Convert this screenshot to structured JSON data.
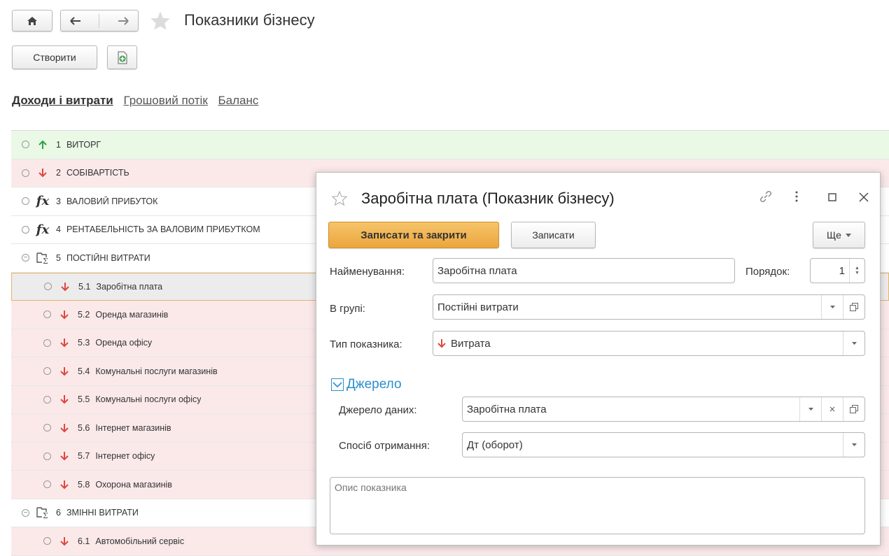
{
  "header": {
    "title": "Показники бізнесу",
    "create_label": "Створити"
  },
  "tabs": [
    {
      "label": "Доходи і витрати",
      "active": true
    },
    {
      "label": "Грошовий потік",
      "active": false
    },
    {
      "label": "Баланс",
      "active": false
    }
  ],
  "list": {
    "rows": [
      {
        "num": "1",
        "name": "ВИТОРГ",
        "icon": "arrow-up-icon",
        "level": 0
      },
      {
        "num": "2",
        "name": "СОБІВАРТІСТЬ",
        "icon": "arrow-down-icon",
        "level": 0
      },
      {
        "num": "3",
        "name": "ВАЛОВИЙ ПРИБУТОК",
        "icon": "formula-icon",
        "level": 0
      },
      {
        "num": "4",
        "name": "РЕНТАБЕЛЬНІСТЬ ЗА ВАЛОВИМ ПРИБУТКОМ",
        "icon": "formula-icon",
        "level": 0
      },
      {
        "num": "5",
        "name": "ПОСТІЙНІ ВИТРАТИ",
        "icon": "group-sum-icon",
        "level": 0
      },
      {
        "num": "5.1",
        "name": "Заробітна плата",
        "icon": "arrow-down-icon",
        "level": 1
      },
      {
        "num": "5.2",
        "name": "Оренда магазинів",
        "icon": "arrow-down-icon",
        "level": 1
      },
      {
        "num": "5.3",
        "name": "Оренда офісу",
        "icon": "arrow-down-icon",
        "level": 1
      },
      {
        "num": "5.4",
        "name": "Комунальні послуги магазинів",
        "icon": "arrow-down-icon",
        "level": 1
      },
      {
        "num": "5.5",
        "name": "Комунальні послуги офісу",
        "icon": "arrow-down-icon",
        "level": 1
      },
      {
        "num": "5.6",
        "name": "Інтернет магазинів",
        "icon": "arrow-down-icon",
        "level": 1
      },
      {
        "num": "5.7",
        "name": "Інтернет офісу",
        "icon": "arrow-down-icon",
        "level": 1
      },
      {
        "num": "5.8",
        "name": "Охорона магазинів",
        "icon": "arrow-down-icon",
        "level": 1
      },
      {
        "num": "6",
        "name": "ЗМІННІ ВИТРАТИ",
        "icon": "group-sum-icon",
        "level": 0
      },
      {
        "num": "6.1",
        "name": "Автомобільний сервіс",
        "icon": "arrow-down-icon",
        "level": 1
      }
    ]
  },
  "dialog": {
    "title": "Заробітна плата (Показник бізнесу)",
    "save_close_label": "Записати та закрити",
    "save_label": "Записати",
    "more_label": "Ще",
    "name_label": "Найменування:",
    "name_value": "Заробітна плата",
    "order_label": "Порядок:",
    "order_value": "1",
    "group_label": "В групі:",
    "group_value": "Постійні витрати",
    "type_label": "Тип показника:",
    "type_value": "Витрата",
    "source_section": "Джерело",
    "source_label": "Джерело даних:",
    "source_value": "Заробітна плата",
    "method_label": "Спосіб отримання:",
    "method_value": "Дт (оборот)",
    "description_placeholder": "Опис показника"
  },
  "colors": {
    "income_green": "#2ca24a",
    "expense_red": "#e0463e",
    "accent_orange": "#f0b24c",
    "link_blue": "#2a8fcf"
  }
}
